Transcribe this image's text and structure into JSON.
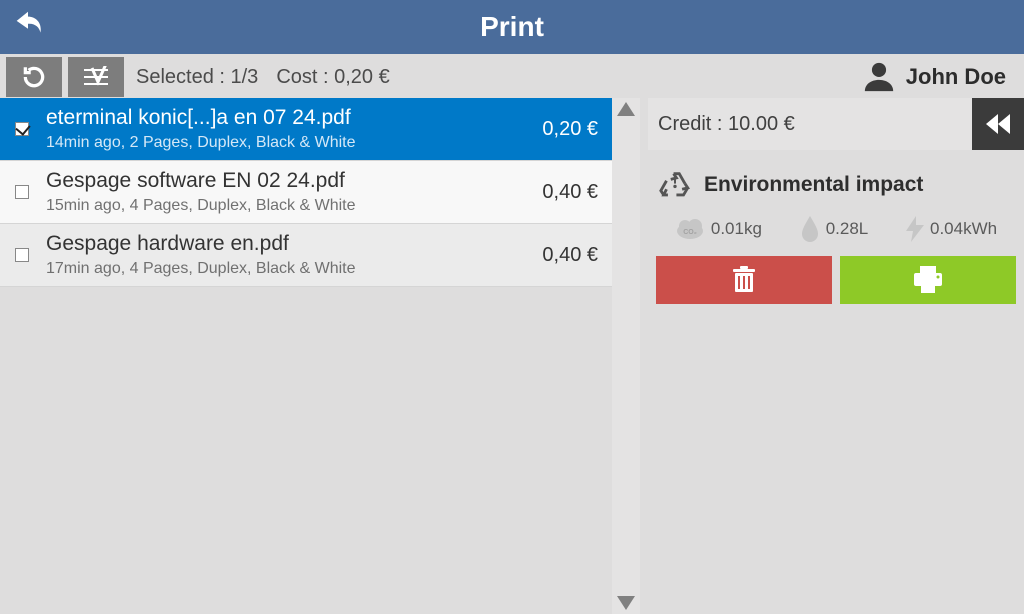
{
  "header": {
    "title": "Print"
  },
  "toolbar": {
    "selected_label": "Selected : 1/3",
    "cost_label": "Cost : 0,20 €"
  },
  "user": {
    "name": "John Doe"
  },
  "credit": {
    "label": "Credit : 10.00 €"
  },
  "env": {
    "title": "Environmental impact",
    "co2": "0.01kg",
    "water": "0.28L",
    "energy": "0.04kWh"
  },
  "jobs": [
    {
      "selected": true,
      "filename": "eterminal konic[...]a en 07 24.pdf",
      "meta": "14min ago, 2 Pages, Duplex, Black & White",
      "cost": "0,20 €"
    },
    {
      "selected": false,
      "filename": "Gespage software EN 02 24.pdf",
      "meta": "15min ago, 4 Pages, Duplex, Black & White",
      "cost": "0,40 €"
    },
    {
      "selected": false,
      "filename": "Gespage hardware en.pdf",
      "meta": "17min ago, 4 Pages, Duplex, Black & White",
      "cost": "0,40 €"
    }
  ]
}
